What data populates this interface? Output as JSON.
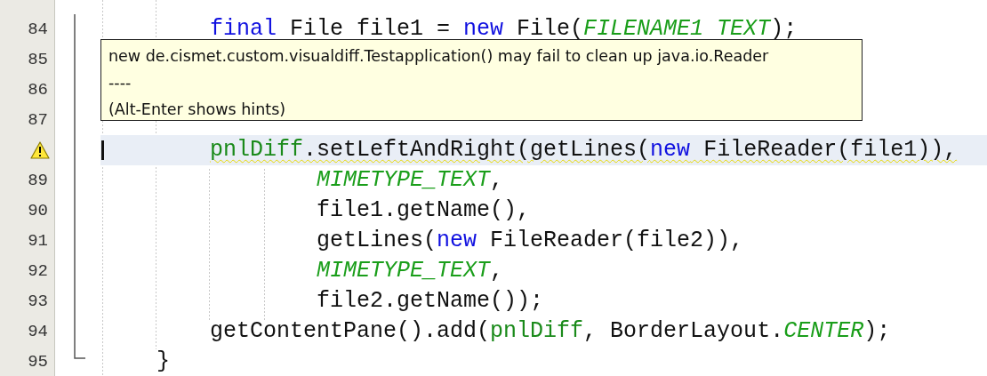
{
  "editor": {
    "lines": [
      {
        "number": "84",
        "warning": false,
        "current": false,
        "kind": "statement",
        "tokens": [
          {
            "kind": "keyword",
            "text": "final"
          },
          {
            "kind": "plain",
            "text": " File file1 = "
          },
          {
            "kind": "keyword",
            "text": "new"
          },
          {
            "kind": "plain",
            "text": " File("
          },
          {
            "kind": "constant",
            "text": "FILENAME1 TEXT"
          },
          {
            "kind": "plain",
            "text": ");"
          }
        ]
      },
      {
        "number": "85",
        "warning": false,
        "current": false
      },
      {
        "number": "86",
        "warning": false,
        "current": false
      },
      {
        "number": "87",
        "warning": false,
        "current": false
      },
      {
        "warning": true,
        "current": true,
        "kind": "statement",
        "tokens": [
          {
            "kind": "field",
            "text": "pnlDiff"
          },
          {
            "kind": "plain",
            "text": ".setLeftAndRight(getLines("
          },
          {
            "kind": "keyword",
            "text": "new"
          },
          {
            "kind": "plain",
            "text": " FileReader(file1)),"
          }
        ]
      },
      {
        "number": "89",
        "warning": false,
        "current": false,
        "kind": "argument",
        "tokens": [
          {
            "kind": "constant",
            "text": "MIMETYPE_TEXT"
          },
          {
            "kind": "plain",
            "text": ","
          }
        ]
      },
      {
        "number": "90",
        "warning": false,
        "current": false,
        "kind": "argument",
        "tokens": [
          {
            "kind": "plain",
            "text": "file1.getName(),"
          }
        ]
      },
      {
        "number": "91",
        "warning": false,
        "current": false,
        "kind": "argument",
        "tokens": [
          {
            "kind": "plain",
            "text": "getLines("
          },
          {
            "kind": "keyword",
            "text": "new"
          },
          {
            "kind": "plain",
            "text": " FileReader(file2)),"
          }
        ]
      },
      {
        "number": "92",
        "warning": false,
        "current": false,
        "kind": "argument",
        "tokens": [
          {
            "kind": "constant",
            "text": "MIMETYPE_TEXT"
          },
          {
            "kind": "plain",
            "text": ","
          }
        ]
      },
      {
        "number": "93",
        "warning": false,
        "current": false,
        "kind": "argument",
        "tokens": [
          {
            "kind": "plain",
            "text": "file2.getName());"
          }
        ]
      },
      {
        "number": "94",
        "warning": false,
        "current": false,
        "kind": "statement",
        "tokens": [
          {
            "kind": "plain",
            "text": "getContentPane().add("
          },
          {
            "kind": "field",
            "text": "pnlDiff"
          },
          {
            "kind": "plain",
            "text": ", BorderLayout."
          },
          {
            "kind": "constant",
            "text": "CENTER"
          },
          {
            "kind": "plain",
            "text": ");"
          }
        ]
      },
      {
        "number": "95",
        "warning": false,
        "current": false,
        "kind": "block_end",
        "tokens": [
          {
            "kind": "plain",
            "text": "}"
          }
        ]
      }
    ]
  },
  "tooltip": {
    "lines": [
      "new de.cismet.custom.visualdiff.Testapplication() may fail to clean up java.io.Reader",
      "----",
      "(Alt-Enter shows hints)"
    ]
  }
}
